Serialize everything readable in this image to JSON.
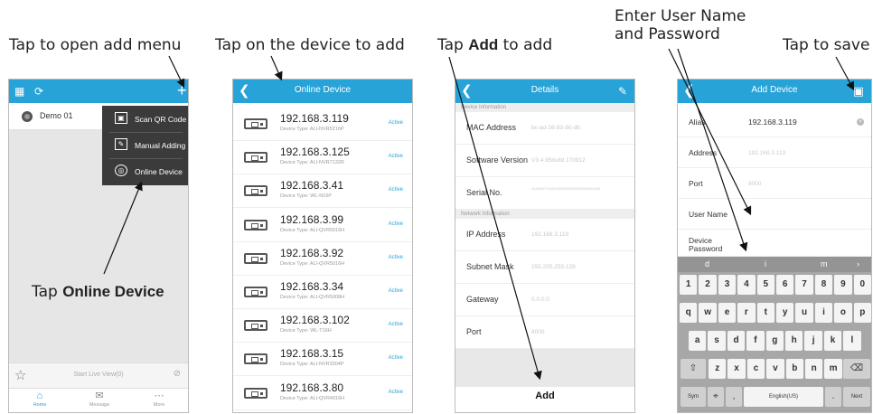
{
  "captions": {
    "c1": "Tap to open add menu",
    "c2": "Tap on the device to add",
    "c3_pre": "Tap ",
    "c3_bold": "Add",
    "c3_post": " to add",
    "c4_line1": "Enter User Name",
    "c4_line2": "and Password",
    "c5": "Tap to save",
    "c6_pre": "Tap ",
    "c6_bold": "Online Device"
  },
  "screen1": {
    "device_name": "Demo 01",
    "menu": [
      "Scan QR Code",
      "Manual Adding",
      "Online Device"
    ],
    "live_view": "Start Live View(0)",
    "tabs": [
      "Home",
      "Message",
      "More"
    ]
  },
  "screen2": {
    "title": "Online Device",
    "devices": [
      {
        "ip": "192.168.3.119",
        "type": "Device Type: ALI-NVR5216P",
        "status": "Active"
      },
      {
        "ip": "192.168.3.125",
        "type": "Device Type: ALI-NVR7132R",
        "status": "Active"
      },
      {
        "ip": "192.168.3.41",
        "type": "Device Type: WL-N16P",
        "status": "Active"
      },
      {
        "ip": "192.168.3.99",
        "type": "Device Type: ALI-QVR5016H",
        "status": "Active"
      },
      {
        "ip": "192.168.3.92",
        "type": "Device Type: ALI-QVR5016H",
        "status": "Active"
      },
      {
        "ip": "192.168.3.34",
        "type": "Device Type: ALI-QVR5008H",
        "status": "Active"
      },
      {
        "ip": "192.168.3.102",
        "type": "Device Type: WL-T16H",
        "status": "Active"
      },
      {
        "ip": "192.168.3.15",
        "type": "Device Type: ALI-NVR3304P",
        "status": "Active"
      },
      {
        "ip": "192.168.3.80",
        "type": "Device Type: ALI-QVR4016H",
        "status": "Active"
      }
    ]
  },
  "screen3": {
    "title": "Details",
    "section1": "Device Information",
    "section2": "Network Information",
    "mac_label": "MAC Address",
    "mac_value": "bc-ad-28-93-90-db",
    "software_label": "Software Version",
    "software_value": "V3.4.95build 170912",
    "serial_label": "Serial No.",
    "serial_value": "4040A071102015000000000000048A4405",
    "ip_label": "IP Address",
    "ip_value": "192.168.3.119",
    "subnet_label": "Subnet Mask",
    "subnet_value": "255.255.255.128",
    "gateway_label": "Gateway",
    "gateway_value": "0.0.0.0",
    "port_label": "Port",
    "port_value": "8000",
    "add_label": "Add"
  },
  "screen4": {
    "title": "Add Device",
    "alias_label": "Alias",
    "alias_value": "192.168.3.119",
    "address_label": "Address",
    "address_value": "192.168.3.119",
    "port_label": "Port",
    "port_value": "8000",
    "username_label": "User Name",
    "password_label": "Device Password",
    "suggestions": [
      "d",
      "i",
      "m"
    ],
    "row1": [
      "1",
      "2",
      "3",
      "4",
      "5",
      "6",
      "7",
      "8",
      "9",
      "0"
    ],
    "row2": [
      "q",
      "w",
      "e",
      "r",
      "t",
      "y",
      "u",
      "i",
      "o",
      "p"
    ],
    "row3": [
      "a",
      "s",
      "d",
      "f",
      "g",
      "h",
      "j",
      "k",
      "l"
    ],
    "row4": [
      "z",
      "x",
      "c",
      "v",
      "b",
      "n",
      "m"
    ],
    "sym": "Sym",
    "comma": ",",
    "space": "English(US)",
    "period": ".",
    "next": "Next"
  },
  "colors": {
    "topbar": "#27a3d8",
    "menu": "#3b3b3b",
    "keyboard": "#a7a7a7"
  }
}
